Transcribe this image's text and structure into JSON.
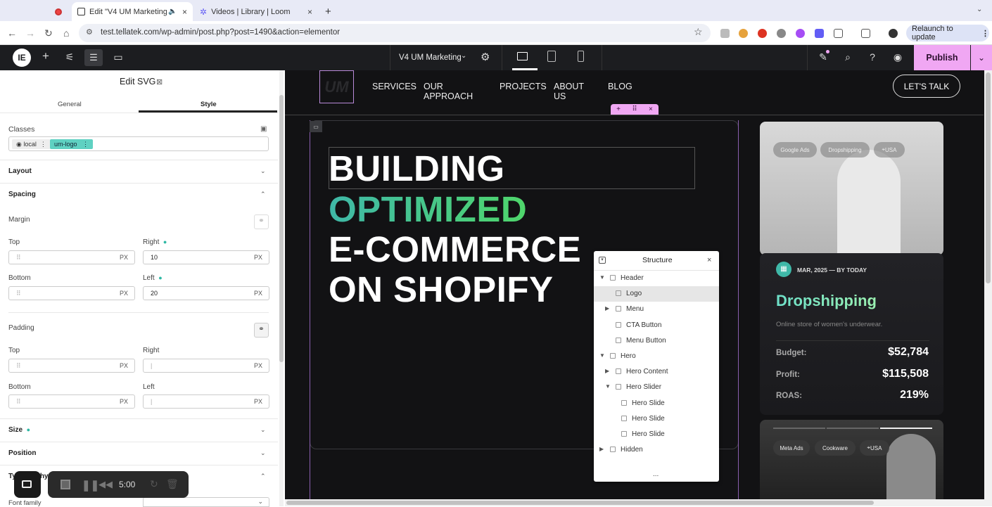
{
  "browser": {
    "tabs": [
      {
        "label": "",
        "active": false
      },
      {
        "label": "Edit \"V4 UM Marketing\" w",
        "active": true
      },
      {
        "label": "Videos | Library | Loom",
        "active": false
      }
    ],
    "new_tab": "+",
    "url": "test.tellatek.com/wp-admin/post.php?post=1490&action=elementor",
    "relaunch": "Relaunch to update"
  },
  "toolbar": {
    "page_title": "V4 UM Marketing",
    "publish_label": "Publish"
  },
  "panel": {
    "title": "Edit SVG",
    "tabs": [
      "General",
      "Style"
    ],
    "active_tab": "Style",
    "classes_label": "Classes",
    "class_chips": [
      "local",
      "um-logo"
    ],
    "sections": {
      "layout": "Layout",
      "spacing": "Spacing",
      "size": "Size",
      "position": "Position",
      "typography": "Typography"
    },
    "margin": {
      "label": "Margin",
      "top_label": "Top",
      "top_value": "",
      "right_label": "Right",
      "right_value": "10",
      "bottom_label": "Bottom",
      "bottom_value": "",
      "left_label": "Left",
      "left_value": "20",
      "unit": "PX"
    },
    "padding": {
      "label": "Padding",
      "top_label": "Top",
      "right_label": "Right",
      "bottom_label": "Bottom",
      "left_label": "Left",
      "unit": "PX"
    },
    "font_family_label": "Font family"
  },
  "site": {
    "logo_text": "UM",
    "nav": [
      "SERVICES",
      "OUR APPROACH",
      "PROJECTS",
      "ABOUT US",
      "BLOG"
    ],
    "cta": "LET'S TALK",
    "hero_lines": [
      "BUILDING",
      "OPTIMIZED",
      "E-COMMERCE",
      "ON SHOPIFY"
    ],
    "accent_gradient": [
      "#3fb8a8",
      "#4fd66b"
    ]
  },
  "card1": {
    "pills": [
      "Google Ads",
      "Dropshipping",
      "USA"
    ]
  },
  "card2": {
    "date": "MAR, 2025 — BY TODAY",
    "title": "Dropshipping",
    "subtitle": "Online store of women's underwear.",
    "stats": [
      {
        "label": "Budget:",
        "value": "$52,784"
      },
      {
        "label": "Profit:",
        "value": "$115,508"
      },
      {
        "label": "ROAS:",
        "value": "219%"
      }
    ]
  },
  "card3": {
    "pills": [
      "Meta Ads",
      "Cookware",
      "USA"
    ]
  },
  "structure": {
    "title": "Structure",
    "items": [
      {
        "label": "Header",
        "indent": 0,
        "arrow": "down"
      },
      {
        "label": "Logo",
        "indent": 1,
        "arrow": "",
        "selected": true
      },
      {
        "label": "Menu",
        "indent": 1,
        "arrow": "right"
      },
      {
        "label": "CTA Button",
        "indent": 1,
        "arrow": ""
      },
      {
        "label": "Menu Button",
        "indent": 1,
        "arrow": ""
      },
      {
        "label": "Hero",
        "indent": 0,
        "arrow": "down"
      },
      {
        "label": "Hero Content",
        "indent": 1,
        "arrow": "right"
      },
      {
        "label": "Hero Slider",
        "indent": 1,
        "arrow": "down"
      },
      {
        "label": "Hero Slide",
        "indent": 2,
        "arrow": ""
      },
      {
        "label": "Hero Slide",
        "indent": 2,
        "arrow": ""
      },
      {
        "label": "Hero Slide",
        "indent": 2,
        "arrow": ""
      },
      {
        "label": "Hidden",
        "indent": 0,
        "arrow": "right"
      }
    ],
    "more": "..."
  },
  "loom": {
    "timer": "5:00"
  }
}
